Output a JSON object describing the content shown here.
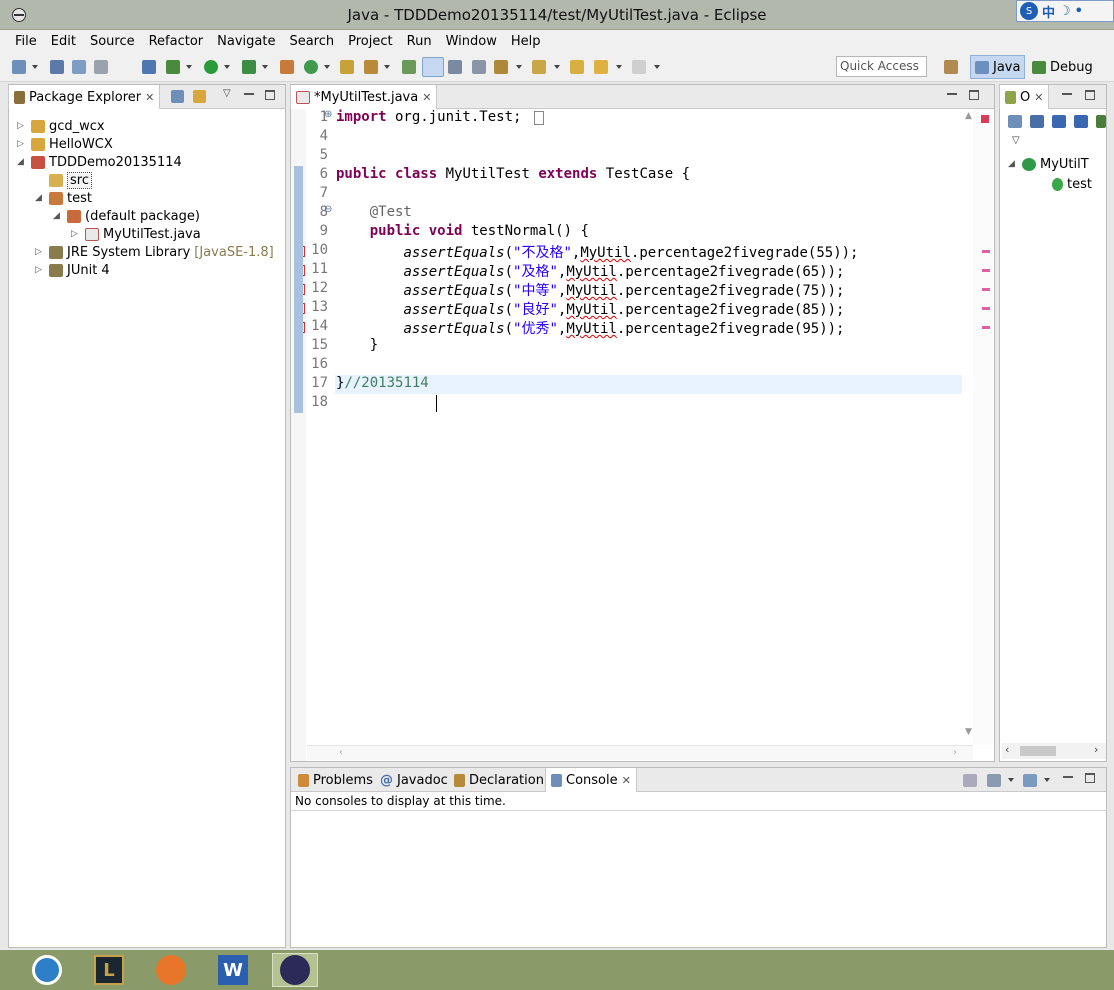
{
  "window": {
    "title": "Java - TDDDemo20135114/test/MyUtilTest.java - Eclipse"
  },
  "ime": {
    "char1": "中"
  },
  "menubar": [
    "File",
    "Edit",
    "Source",
    "Refactor",
    "Navigate",
    "Search",
    "Project",
    "Run",
    "Window",
    "Help"
  ],
  "toolbar": {
    "quick_access_placeholder": "Quick Access"
  },
  "perspectives": {
    "java": "Java",
    "debug": "Debug"
  },
  "package_explorer": {
    "title": "Package Explorer",
    "items": [
      {
        "label": "gcd_wcx"
      },
      {
        "label": "HelloWCX"
      },
      {
        "label": "TDDDemo20135114"
      },
      {
        "label": "src"
      },
      {
        "label": "test"
      },
      {
        "label": "(default package)"
      },
      {
        "label": "MyUtilTest.java"
      },
      {
        "label": "JRE System Library",
        "decoration": "[JavaSE-1.8]"
      },
      {
        "label": "JUnit 4"
      }
    ]
  },
  "editor": {
    "tab_label": "*MyUtilTest.java",
    "lines": [
      {
        "n": "1",
        "tokens": [
          {
            "t": "import",
            "c": "kw"
          },
          {
            "t": " org.junit.Test;"
          }
        ]
      },
      {
        "n": "4",
        "tokens": []
      },
      {
        "n": "5",
        "tokens": []
      },
      {
        "n": "6",
        "tokens": [
          {
            "t": "public",
            "c": "kw"
          },
          {
            "t": " "
          },
          {
            "t": "class",
            "c": "kw"
          },
          {
            "t": " MyUtilTest "
          },
          {
            "t": "extends",
            "c": "kw"
          },
          {
            "t": " TestCase {"
          }
        ]
      },
      {
        "n": "7",
        "tokens": []
      },
      {
        "n": "8",
        "tokens": [
          {
            "t": "    "
          },
          {
            "t": "@Test",
            "c": "an"
          }
        ]
      },
      {
        "n": "9",
        "tokens": [
          {
            "t": "    "
          },
          {
            "t": "public",
            "c": "kw"
          },
          {
            "t": " "
          },
          {
            "t": "void",
            "c": "kw"
          },
          {
            "t": " testNormal() {"
          }
        ]
      },
      {
        "n": "10",
        "tokens": [
          {
            "t": "        "
          },
          {
            "t": "assertEquals",
            "c": "it"
          },
          {
            "t": "("
          },
          {
            "t": "\"不及格\"",
            "c": "st"
          },
          {
            "t": ","
          },
          {
            "t": "MyUtil",
            "c": "sq"
          },
          {
            "t": ".percentage2fivegrade(55));"
          }
        ]
      },
      {
        "n": "11",
        "tokens": [
          {
            "t": "        "
          },
          {
            "t": "assertEquals",
            "c": "it"
          },
          {
            "t": "("
          },
          {
            "t": "\"及格\"",
            "c": "st"
          },
          {
            "t": ","
          },
          {
            "t": "MyUtil",
            "c": "sq"
          },
          {
            "t": ".percentage2fivegrade(65));"
          }
        ]
      },
      {
        "n": "12",
        "tokens": [
          {
            "t": "        "
          },
          {
            "t": "assertEquals",
            "c": "it"
          },
          {
            "t": "("
          },
          {
            "t": "\"中等\"",
            "c": "st"
          },
          {
            "t": ","
          },
          {
            "t": "MyUtil",
            "c": "sq"
          },
          {
            "t": ".percentage2fivegrade(75));"
          }
        ]
      },
      {
        "n": "13",
        "tokens": [
          {
            "t": "        "
          },
          {
            "t": "assertEquals",
            "c": "it"
          },
          {
            "t": "("
          },
          {
            "t": "\"良好\"",
            "c": "st"
          },
          {
            "t": ","
          },
          {
            "t": "MyUtil",
            "c": "sq"
          },
          {
            "t": ".percentage2fivegrade(85));"
          }
        ]
      },
      {
        "n": "14",
        "tokens": [
          {
            "t": "        "
          },
          {
            "t": "assertEquals",
            "c": "it"
          },
          {
            "t": "("
          },
          {
            "t": "\"优秀\"",
            "c": "st"
          },
          {
            "t": ","
          },
          {
            "t": "MyUtil",
            "c": "sq"
          },
          {
            "t": ".percentage2fivegrade(95));"
          }
        ]
      },
      {
        "n": "15",
        "tokens": [
          {
            "t": "    }"
          }
        ]
      },
      {
        "n": "16",
        "tokens": []
      },
      {
        "n": "17",
        "tokens": [
          {
            "t": "}"
          },
          {
            "t": "//20135114",
            "c": "cm"
          }
        ]
      },
      {
        "n": "18",
        "tokens": []
      }
    ]
  },
  "outline": {
    "title": "O",
    "items": [
      "MyUtilT",
      "test"
    ]
  },
  "bottom": {
    "tabs": [
      "Problems",
      "Javadoc",
      "Declaration",
      "Console"
    ],
    "console_message": "No consoles to display at this time."
  },
  "taskbar": {
    "word_letter": "W",
    "lol_letter": "L"
  },
  "colors": {
    "titlebar": "#b3b8ad",
    "taskbar": "#8a9a68",
    "keyword": "#7f0055",
    "string": "#2a00ff",
    "comment": "#3f7f5f"
  }
}
